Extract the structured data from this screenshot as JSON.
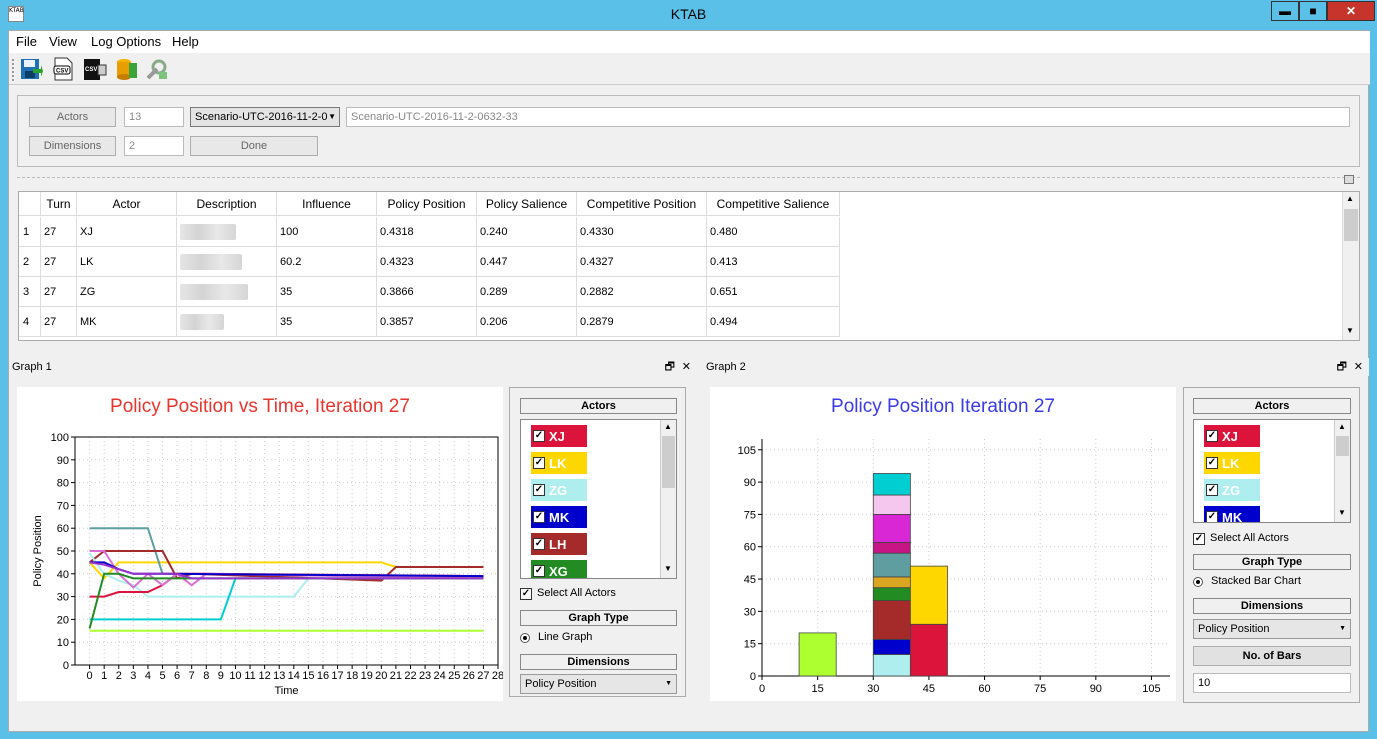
{
  "window": {
    "title": "KTAB",
    "icon_label": "KTAB",
    "min": "▬",
    "max": "■",
    "close": "✕"
  },
  "menu": [
    "File",
    "View",
    "Log Options",
    "Help"
  ],
  "toolbar": [
    "save-icon",
    "csv-export-icon",
    "csv-import-icon",
    "database-icon",
    "settings-tools-icon"
  ],
  "top_panel": {
    "actors_btn": "Actors",
    "actors_count": "13",
    "scenario_combo": "Scenario-UTC-2016-11-2-0",
    "scenario_name": "Scenario-UTC-2016-11-2-0632-33",
    "dimensions_btn": "Dimensions",
    "dimensions_count": "2",
    "done_btn": "Done"
  },
  "table": {
    "headers": [
      "Turn",
      "Actor",
      "Description",
      "Influence",
      "Policy Position",
      "Policy Salience",
      "Competitive Position",
      "Competitive Salience"
    ],
    "rows": [
      {
        "n": "1",
        "turn": "27",
        "actor": "XJ",
        "influence": "100",
        "pp": "0.4318",
        "ps": "0.240",
        "cp": "0.4330",
        "cs": "0.480"
      },
      {
        "n": "2",
        "turn": "27",
        "actor": "LK",
        "influence": "60.2",
        "pp": "0.4323",
        "ps": "0.447",
        "cp": "0.4327",
        "cs": "0.413"
      },
      {
        "n": "3",
        "turn": "27",
        "actor": "ZG",
        "influence": "35",
        "pp": "0.3866",
        "ps": "0.289",
        "cp": "0.2882",
        "cs": "0.651"
      },
      {
        "n": "4",
        "turn": "27",
        "actor": "MK",
        "influence": "35",
        "pp": "0.3857",
        "ps": "0.206",
        "cp": "0.2879",
        "cs": "0.494"
      }
    ]
  },
  "graph1": {
    "dock_title": "Graph 1",
    "float": "🗗",
    "close": "✕",
    "actors_header": "Actors",
    "actors": [
      {
        "name": "XJ",
        "color": "#dc143c"
      },
      {
        "name": "LK",
        "color": "#ffd700"
      },
      {
        "name": "ZG",
        "color": "#afeeee"
      },
      {
        "name": "MK",
        "color": "#0000cd"
      },
      {
        "name": "LH",
        "color": "#a52a2a"
      },
      {
        "name": "XG",
        "color": "#228b22"
      }
    ],
    "select_all": "Select All Actors",
    "graph_type_header": "Graph Type",
    "graph_type": "Line Graph",
    "dimensions_header": "Dimensions",
    "dimension": "Policy Position"
  },
  "graph2": {
    "dock_title": "Graph 2",
    "float": "🗗",
    "close": "✕",
    "actors_header": "Actors",
    "actors": [
      {
        "name": "XJ",
        "color": "#dc143c"
      },
      {
        "name": "LK",
        "color": "#ffd700"
      },
      {
        "name": "ZG",
        "color": "#afeeee"
      },
      {
        "name": "MK",
        "color": "#0000cd"
      }
    ],
    "select_all": "Select All Actors",
    "graph_type_header": "Graph Type",
    "graph_type": "Stacked Bar Chart",
    "dimensions_header": "Dimensions",
    "dimension": "Policy Position",
    "bars_header": "No. of Bars",
    "bars_value": "10"
  },
  "chart_data": [
    {
      "type": "line",
      "title": "Policy Position vs Time, Iteration 27",
      "title_color": "#e8352e",
      "xlabel": "Time",
      "ylabel": "Policy Position",
      "xlim": [
        -1,
        28
      ],
      "ylim": [
        0,
        100
      ],
      "xticks": [
        0,
        1,
        2,
        3,
        4,
        5,
        6,
        7,
        8,
        9,
        10,
        11,
        12,
        13,
        14,
        15,
        16,
        17,
        18,
        19,
        20,
        21,
        22,
        23,
        24,
        25,
        26,
        27,
        28
      ],
      "yticks": [
        0,
        10,
        20,
        30,
        40,
        50,
        60,
        70,
        80,
        90,
        100
      ],
      "grid": true,
      "series": [
        {
          "color": "#adff2f",
          "x": [
            0,
            27
          ],
          "y": [
            15,
            15
          ]
        },
        {
          "color": "#ffd700",
          "x": [
            0,
            1,
            2,
            3,
            4,
            5,
            6,
            20,
            21,
            27
          ],
          "y": [
            45,
            38,
            45,
            45,
            45,
            45,
            45,
            45,
            43,
            43
          ]
        },
        {
          "color": "#5f9ea0",
          "x": [
            0,
            1,
            2,
            3,
            4,
            5,
            6,
            27
          ],
          "y": [
            60,
            60,
            60,
            60,
            60,
            40,
            40,
            39
          ]
        },
        {
          "color": "#a52a2a",
          "x": [
            0,
            1,
            2,
            3,
            4,
            5,
            6,
            7,
            20,
            21,
            27
          ],
          "y": [
            45,
            50,
            50,
            50,
            50,
            50,
            38,
            40,
            37,
            43,
            43
          ]
        },
        {
          "color": "#afeeee",
          "x": [
            0,
            1,
            2,
            3,
            4,
            14,
            15,
            27
          ],
          "y": [
            49,
            40,
            37,
            35,
            30,
            30,
            38,
            38
          ]
        },
        {
          "color": "#00ced1",
          "x": [
            0,
            1,
            2,
            3,
            4,
            5,
            8,
            9,
            10,
            27
          ],
          "y": [
            20,
            20,
            20,
            20,
            20,
            20,
            20,
            20,
            38,
            38
          ]
        },
        {
          "color": "#dc143c",
          "x": [
            0,
            1,
            2,
            3,
            4,
            5,
            6,
            7,
            8,
            27
          ],
          "y": [
            30,
            30,
            32,
            32,
            32,
            35,
            40,
            40,
            40,
            39
          ]
        },
        {
          "color": "#da70d6",
          "x": [
            0,
            1,
            2,
            3,
            4,
            5,
            6,
            7,
            8,
            27
          ],
          "y": [
            50,
            50,
            40,
            34,
            40,
            35,
            40,
            35,
            40,
            38
          ]
        },
        {
          "color": "#0000cd",
          "x": [
            0,
            1,
            2,
            3,
            4,
            5,
            27
          ],
          "y": [
            45,
            45,
            42,
            40,
            40,
            40,
            39
          ]
        },
        {
          "color": "#228b22",
          "x": [
            0,
            1,
            2,
            3,
            27
          ],
          "y": [
            16,
            40,
            40,
            38,
            38
          ]
        },
        {
          "color": "#9932cc",
          "x": [
            0,
            1,
            2,
            3,
            4,
            5,
            6,
            7,
            27
          ],
          "y": [
            45,
            44,
            42,
            40,
            40,
            40,
            40,
            38,
            38
          ]
        }
      ]
    },
    {
      "type": "bar",
      "stacked": true,
      "title": "Policy Position Iteration 27",
      "title_color": "#3a3ae8",
      "xlim": [
        0,
        110
      ],
      "ylim": [
        0,
        110
      ],
      "xticks": [
        0,
        15,
        30,
        45,
        60,
        75,
        90,
        105
      ],
      "yticks": [
        0,
        15,
        30,
        45,
        60,
        75,
        90,
        105
      ],
      "grid": true,
      "bars": [
        {
          "x0": 10,
          "x1": 20,
          "segments": [
            {
              "color": "#adff2f",
              "value": 20
            }
          ]
        },
        {
          "x0": 30,
          "x1": 40,
          "segments": [
            {
              "color": "#afeeee",
              "value": 10
            },
            {
              "color": "#0000cd",
              "value": 7
            },
            {
              "color": "#a52a2a",
              "value": 18
            },
            {
              "color": "#228b22",
              "value": 6
            },
            {
              "color": "#daa520",
              "value": 5
            },
            {
              "color": "#5f9ea0",
              "value": 11
            },
            {
              "color": "#c71585",
              "value": 5
            },
            {
              "color": "#da27d6",
              "value": 13
            },
            {
              "color": "#f5c6ee",
              "value": 9
            },
            {
              "color": "#00ced1",
              "value": 10
            }
          ]
        },
        {
          "x0": 40,
          "x1": 50,
          "segments": [
            {
              "color": "#dc143c",
              "value": 24
            },
            {
              "color": "#ffd700",
              "value": 27
            }
          ]
        }
      ]
    }
  ]
}
